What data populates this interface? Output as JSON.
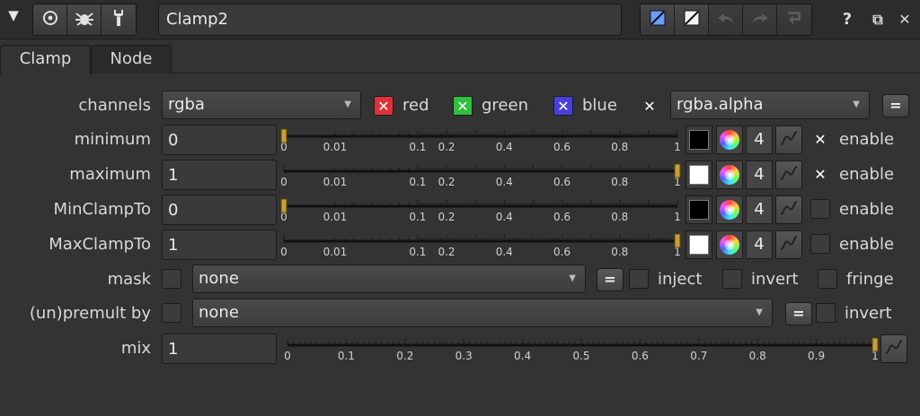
{
  "titlebar": {
    "collapse_glyph": "▼",
    "node_name": "Clamp2",
    "help_glyph": "?",
    "float_glyph": "⧉",
    "close_glyph": "✕",
    "icons": [
      "circle-target-icon",
      "bug-icon",
      "wrench-icon",
      "input-color-icon",
      "output-color-icon",
      "undo-icon",
      "redo-icon",
      "revert-icon"
    ]
  },
  "tabs": [
    {
      "label": "Clamp",
      "active": true
    },
    {
      "label": "Node",
      "active": false
    }
  ],
  "channels": {
    "label": "channels",
    "value": "rgba",
    "red": "red",
    "green": "green",
    "blue": "blue",
    "alpha_value": "rgba.alpha",
    "eq": "=",
    "colors": {
      "red": "#e0303a",
      "green": "#30c040",
      "blue": "#4a3ee0"
    }
  },
  "sliders": {
    "ticks_small": [
      "0",
      "0.01",
      "0.1",
      "0.2",
      "0.4",
      "0.6",
      "0.8",
      "1"
    ],
    "ticks_mix": [
      "0",
      "0.1",
      "0.2",
      "0.3",
      "0.4",
      "0.5",
      "0.6",
      "0.7",
      "0.8",
      "0.9",
      "1"
    ]
  },
  "rows": [
    {
      "label": "minimum",
      "value": "0",
      "slider": 0,
      "swatch": "#000000",
      "channels_count": "4",
      "enable_checked": true,
      "enable_label": "enable"
    },
    {
      "label": "maximum",
      "value": "1",
      "slider": 1,
      "swatch": "#ffffff",
      "channels_count": "4",
      "enable_checked": true,
      "enable_label": "enable"
    },
    {
      "label": "MinClampTo",
      "value": "0",
      "slider": 0,
      "swatch": "#000000",
      "channels_count": "4",
      "enable_checked": false,
      "enable_label": "enable"
    },
    {
      "label": "MaxClampTo",
      "value": "1",
      "slider": 1,
      "swatch": "#ffffff",
      "channels_count": "4",
      "enable_checked": false,
      "enable_label": "enable"
    }
  ],
  "mask": {
    "label": "mask",
    "value": "none",
    "eq": "=",
    "inject": "inject",
    "invert": "invert",
    "fringe": "fringe"
  },
  "premult": {
    "label": "(un)premult by",
    "value": "none",
    "eq": "=",
    "invert": "invert"
  },
  "mix": {
    "label": "mix",
    "value": "1",
    "slider": 1
  }
}
